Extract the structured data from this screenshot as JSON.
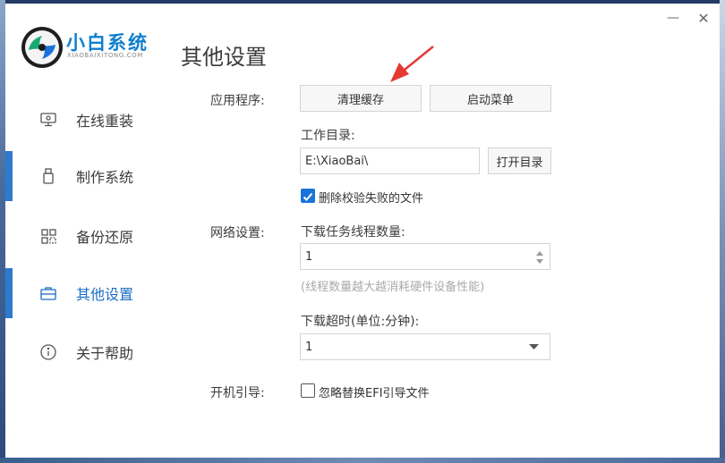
{
  "brand": {
    "name_cn": "小白系统",
    "name_en": "XIAOBAIXITONG.COM"
  },
  "page_title": "其他设置",
  "window_controls": {
    "minimize": "—",
    "close": "✕"
  },
  "nav": [
    {
      "label": "在线重装",
      "icon": "monitor-icon"
    },
    {
      "label": "制作系统",
      "icon": "usb-drive-icon"
    },
    {
      "label": "备份还原",
      "icon": "grid-icon"
    },
    {
      "label": "其他设置",
      "icon": "briefcase-icon",
      "active": true
    },
    {
      "label": "关于帮助",
      "icon": "info-icon"
    }
  ],
  "app": {
    "label": "应用程序:",
    "clear_cache": "清理缓存",
    "boot_menu": "启动菜单",
    "workdir_label": "工作目录:",
    "workdir_value": "E:\\XiaoBai\\",
    "open_dir": "打开目录",
    "delete_failed_label": "删除校验失败的文件",
    "delete_failed_checked": true
  },
  "network": {
    "label": "网络设置:",
    "threads_label": "下载任务线程数量:",
    "threads_value": "1",
    "threads_hint": "(线程数量越大越消耗硬件设备性能)",
    "timeout_label": "下载超时(单位:分钟):",
    "timeout_value": "1"
  },
  "boot": {
    "label": "开机引导:",
    "ignore_efi_label": "忽略替换EFI引导文件",
    "ignore_efi_checked": false
  },
  "colors": {
    "accent": "#1a6dc4",
    "arrow": "#e53935",
    "brand": "#0f7fd0"
  }
}
